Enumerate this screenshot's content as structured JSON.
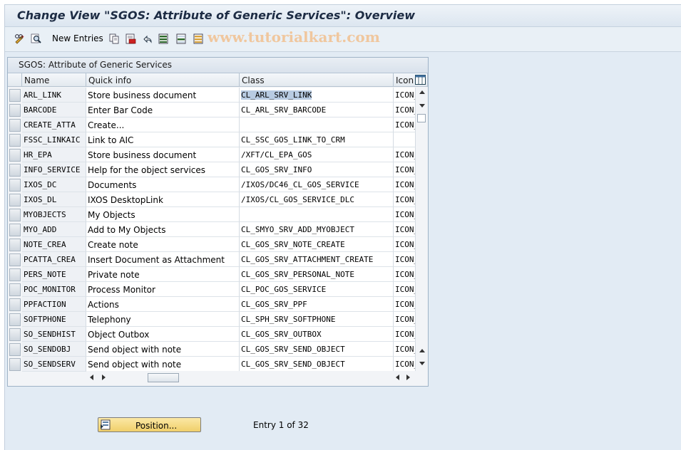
{
  "window": {
    "title": "Change View \"SGOS: Attribute of Generic Services\": Overview"
  },
  "toolbar": {
    "new_entries_label": "New Entries",
    "icons": [
      "display-change-icon",
      "find-icon",
      "copy-icon",
      "delete-icon",
      "undo-icon",
      "select-all-icon",
      "select-block-icon",
      "deselect-all-icon"
    ]
  },
  "watermark": "www.tutorialkart.com",
  "table": {
    "title": "SGOS: Attribute of Generic Services",
    "columns": [
      "Name",
      "Quick info",
      "Class",
      "Icon"
    ],
    "rows": [
      {
        "name": "ARL_LINK",
        "info": "Store business document",
        "class": "CL_ARL_SRV_LINK",
        "icon": "ICON_"
      },
      {
        "name": "BARCODE",
        "info": "Enter Bar Code",
        "class": "CL_ARL_SRV_BARCODE",
        "icon": "ICON_"
      },
      {
        "name": "CREATE_ATTA",
        "info": "Create...",
        "class": "",
        "icon": "ICON_"
      },
      {
        "name": "FSSC_LINKAIC",
        "info": "Link to AIC",
        "class": "CL_SSC_GOS_LINK_TO_CRM",
        "icon": ""
      },
      {
        "name": "HR_EPA",
        "info": "Store business document",
        "class": "/XFT/CL_EPA_GOS",
        "icon": "ICON_"
      },
      {
        "name": "INFO_SERVICE",
        "info": "Help for the object services",
        "class": "CL_GOS_SRV_INFO",
        "icon": "ICON_"
      },
      {
        "name": "IXOS_DC",
        "info": "Documents",
        "class": "/IXOS/DC46_CL_GOS_SERVICE",
        "icon": "ICON_"
      },
      {
        "name": "IXOS_DL",
        "info": "IXOS DesktopLink",
        "class": "/IXOS/CL_GOS_SERVICE_DLC",
        "icon": "ICON_"
      },
      {
        "name": "MYOBJECTS",
        "info": "My Objects",
        "class": "",
        "icon": "ICON_"
      },
      {
        "name": "MYO_ADD",
        "info": "Add to My Objects",
        "class": "CL_SMYO_SRV_ADD_MYOBJECT",
        "icon": "ICON_"
      },
      {
        "name": "NOTE_CREA",
        "info": "Create note",
        "class": "CL_GOS_SRV_NOTE_CREATE",
        "icon": "ICON_"
      },
      {
        "name": "PCATTA_CREA",
        "info": "Insert Document as Attachment",
        "class": "CL_GOS_SRV_ATTACHMENT_CREATE",
        "icon": "ICON_"
      },
      {
        "name": "PERS_NOTE",
        "info": "Private note",
        "class": "CL_GOS_SRV_PERSONAL_NOTE",
        "icon": "ICON_"
      },
      {
        "name": "POC_MONITOR",
        "info": "Process Monitor",
        "class": "CL_POC_GOS_SERVICE",
        "icon": "ICON_"
      },
      {
        "name": "PPFACTION",
        "info": "Actions",
        "class": "CL_GOS_SRV_PPF",
        "icon": "ICON_"
      },
      {
        "name": "SOFTPHONE",
        "info": "Telephony",
        "class": "CL_SPH_SRV_SOFTPHONE",
        "icon": "ICON_"
      },
      {
        "name": "SO_SENDHIST",
        "info": "Object Outbox",
        "class": "CL_GOS_SRV_OUTBOX",
        "icon": "ICON_"
      },
      {
        "name": "SO_SENDOBJ",
        "info": "Send object with note",
        "class": "CL_GOS_SRV_SEND_OBJECT",
        "icon": "ICON_"
      },
      {
        "name": "SO_SENDSERV",
        "info": "Send object with note",
        "class": "CL_GOS_SRV_SEND_OBJECT",
        "icon": "ICON_"
      }
    ]
  },
  "footer": {
    "position_button": "Position...",
    "entry_text": "Entry 1 of 32"
  }
}
